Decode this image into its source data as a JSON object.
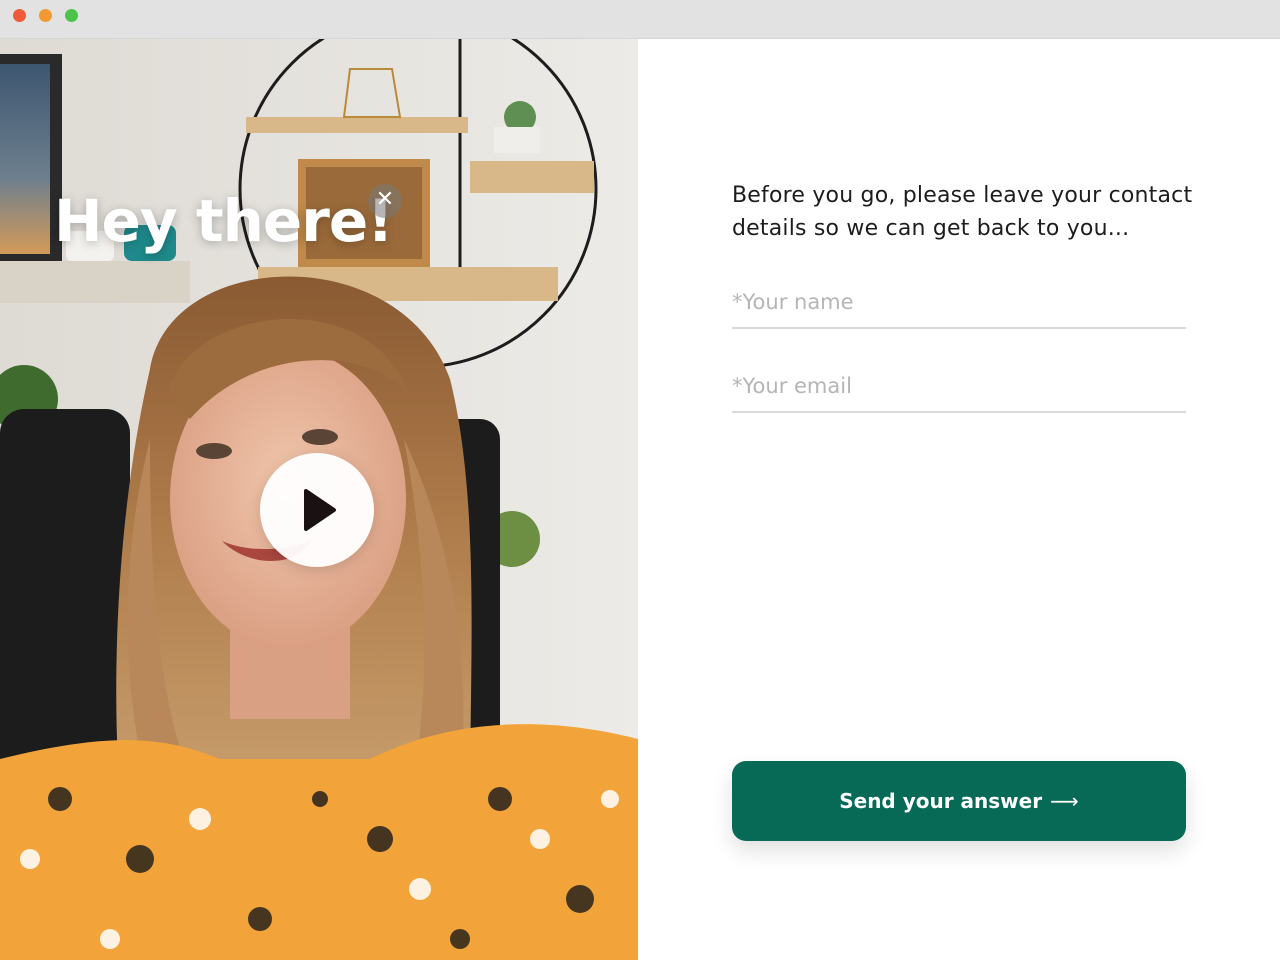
{
  "window": {
    "controls": [
      "close",
      "minimize",
      "maximize"
    ]
  },
  "video": {
    "title": "Hey there!",
    "close_icon": "✕",
    "play_icon": "play-icon"
  },
  "form": {
    "prompt": "Before you go, please leave your contact details so we can get back to you...",
    "name_placeholder": "*Your name",
    "email_placeholder": "*Your email",
    "submit_label": "Send your answer",
    "submit_arrow": "⟶"
  },
  "colors": {
    "accent": "#066a56",
    "close_dot": "#ee5a3a",
    "minimize_dot": "#f29a32",
    "maximize_dot": "#4cc44a"
  }
}
